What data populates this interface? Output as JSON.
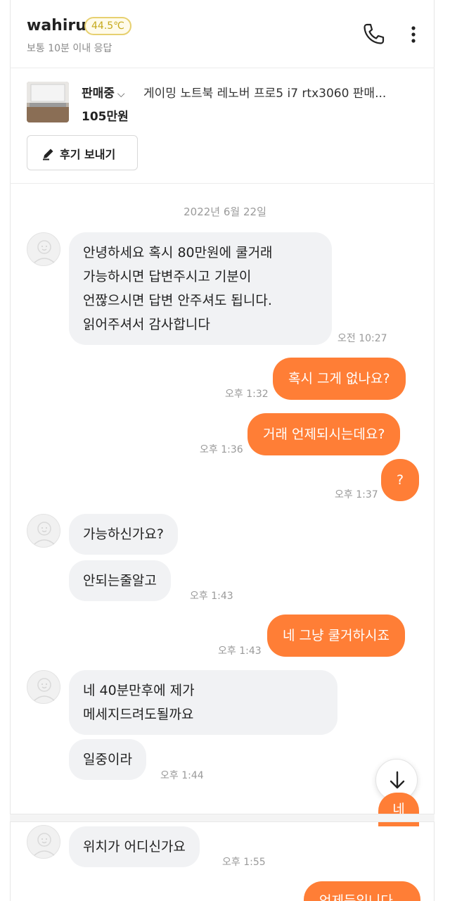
{
  "header": {
    "seller_name": "wahiru",
    "temperature": "44.5℃",
    "response_time": "보통 10분 이내 응답"
  },
  "product": {
    "status": "판매중",
    "title": "게이밍 노트북 레노버 프로5 i7 rtx3060 판매...",
    "price": "105만원",
    "review_button": "후기 보내기"
  },
  "chat": {
    "date": "2022년 6월 22일",
    "m1": {
      "text": "안녕하세요 혹시 80만원에 쿨거래\n가능하시면 답변주시고 기분이\n언짢으시면 답변 안주셔도 됩니다.\n읽어주셔서 감사합니다",
      "time": "오전 10:27"
    },
    "m2": {
      "text": "혹시 그게 없나요?",
      "time": "오후 1:32"
    },
    "m3": {
      "text": "거래 언제되시는데요?",
      "time": "오후 1:36"
    },
    "m4": {
      "text": "?",
      "time": "오후 1:37"
    },
    "m5": {
      "text": "가능하신가요?"
    },
    "m6": {
      "text": "안되는줄알고",
      "time": "오후 1:43"
    },
    "m7": {
      "text": "네 그냥 쿨거하시죠",
      "time": "오후 1:43"
    },
    "m8": {
      "text": "네 40분만후에 제가\n메세지드려도될까요"
    },
    "m9": {
      "text": "일중이라",
      "time": "오후 1:44"
    },
    "m10": {
      "text": "네"
    },
    "m11": {
      "text": "위치가 어디신가요",
      "time": "오후 1:55"
    },
    "m12": {
      "text": "언제든입니다"
    }
  },
  "colors": {
    "accent": "#ff7e36",
    "incoming_bubble": "#f1f2f4",
    "temperature_badge": "#e7d070"
  },
  "icons": [
    "phone-icon",
    "more-vertical-icon",
    "pencil-icon",
    "chevron-down-icon",
    "arrow-down-icon",
    "avatar-icon"
  ]
}
